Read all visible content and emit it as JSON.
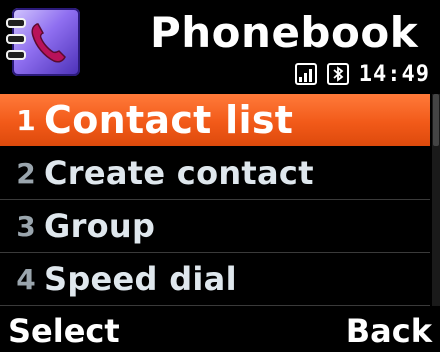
{
  "header": {
    "title": "Phonebook",
    "app_icon": "phonebook-icon",
    "status": {
      "signal_icon": "signal-strength-icon",
      "bluetooth_icon": "bluetooth-icon",
      "time": "14:49"
    }
  },
  "menu": {
    "items": [
      {
        "number": "1",
        "label": "Contact list",
        "selected": true
      },
      {
        "number": "2",
        "label": "Create contact",
        "selected": false
      },
      {
        "number": "3",
        "label": "Group",
        "selected": false
      },
      {
        "number": "4",
        "label": "Speed dial",
        "selected": false
      }
    ]
  },
  "softkeys": {
    "left": "Select",
    "right": "Back"
  },
  "colors": {
    "selection": "#f25a19",
    "background": "#000000",
    "text": "#dfe7ed",
    "icon_purple": "#8f6ff0"
  }
}
